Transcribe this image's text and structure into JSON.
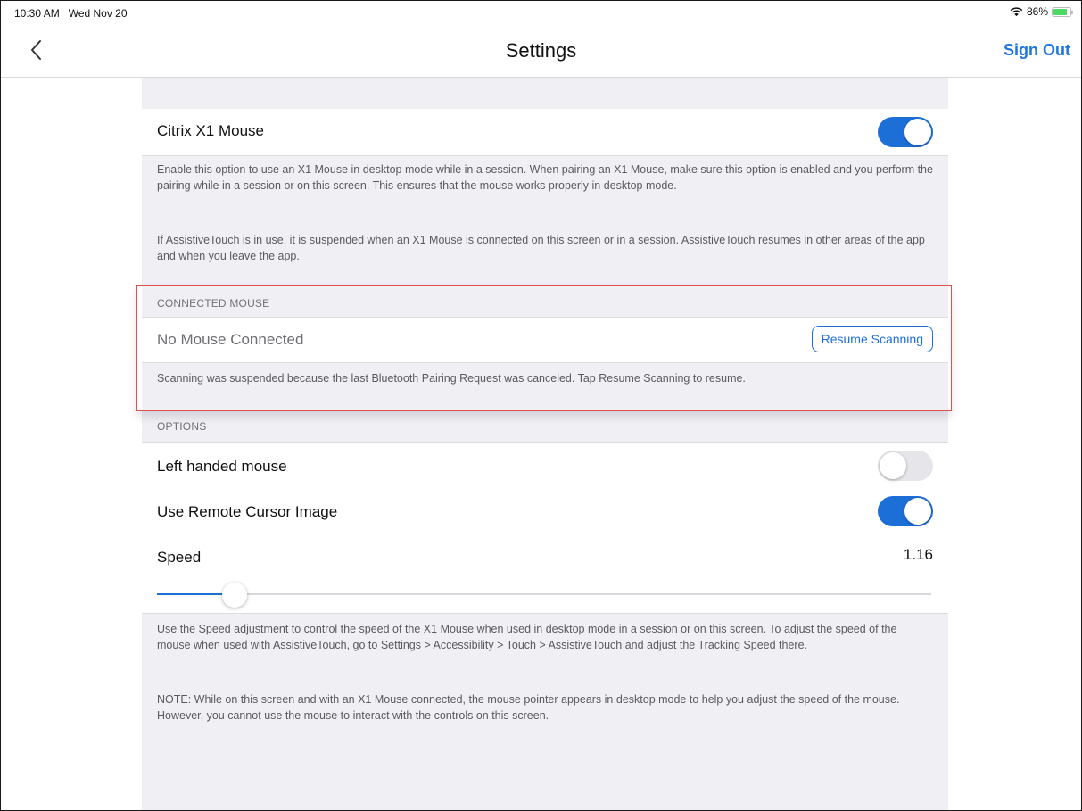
{
  "status_bar": {
    "time": "10:30 AM",
    "date": "Wed Nov 20",
    "battery": "86%",
    "battery_level": 0.86,
    "icons": [
      "wifi-icon",
      "battery-icon"
    ]
  },
  "nav": {
    "back_icon": "chevron-left-icon",
    "title": "Settings",
    "sign_out": "Sign Out"
  },
  "x1_mouse": {
    "label": "Citrix X1 Mouse",
    "enabled": true,
    "description_1": "Enable this option to use an X1 Mouse in desktop mode while in a session. When pairing an X1 Mouse, make sure this option is enabled and you perform the pairing while in a session or on this screen. This ensures that the mouse works properly in desktop mode.",
    "description_2": "If AssistiveTouch is in use, it is suspended when an X1 Mouse is connected on this screen or in a session. AssistiveTouch resumes in other areas of the app and when you leave the app."
  },
  "connected_mouse": {
    "header": "CONNECTED MOUSE",
    "status": "No Mouse Connected",
    "resume_button": "Resume Scanning",
    "note": "Scanning was suspended because the last Bluetooth Pairing Request was canceled. Tap Resume Scanning to resume."
  },
  "options": {
    "header": "OPTIONS",
    "left_handed": {
      "label": "Left handed mouse",
      "enabled": false
    },
    "remote_cursor": {
      "label": "Use Remote Cursor Image",
      "enabled": true
    },
    "speed": {
      "label": "Speed",
      "value": "1.16",
      "slider_fraction": 0.1
    }
  },
  "footer": {
    "description_1": "Use the Speed adjustment to control the speed of the X1 Mouse when used in desktop mode in a session or on this screen. To adjust the speed of the mouse when used with AssistiveTouch, go to Settings > Accessibility > Touch > AssistiveTouch and adjust the Tracking Speed there.",
    "description_2": "NOTE: While on this screen and with an X1 Mouse connected, the mouse pointer appears in desktop mode to help you adjust the speed of the mouse. However, you cannot use the mouse to interact with the controls on this screen."
  },
  "colors": {
    "accent": "#1d6fd8",
    "highlight_border": "#e15050",
    "group_bg": "#efeff4"
  }
}
